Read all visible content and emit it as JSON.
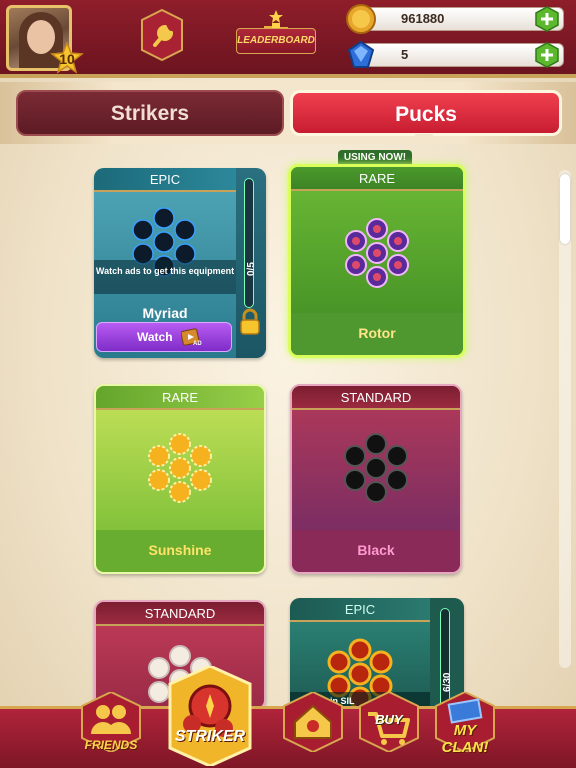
{
  "header": {
    "level": "10",
    "leaderboard_label": "LEADERBOARD",
    "coins": "961880",
    "gems": "5"
  },
  "tabs": [
    {
      "label": "Strikers",
      "active": false
    },
    {
      "label": "Pucks",
      "active": true
    }
  ],
  "cards": [
    {
      "rarity": "EPIC",
      "name": "Myriad",
      "overlay_text": "Watch ads to get this equipment",
      "progress": "0/5",
      "button_label": "Watch",
      "ad_icon_label": "AD",
      "locked": true
    },
    {
      "rarity": "RARE",
      "name": "Rotor",
      "badge": "USING NOW!"
    },
    {
      "rarity": "RARE",
      "name": "Sunshine"
    },
    {
      "rarity": "STANDARD",
      "name": "Black"
    },
    {
      "rarity": "STANDARD",
      "name": ""
    },
    {
      "rarity": "EPIC",
      "name": "",
      "progress": "6/30",
      "overlay_text": "in SIL"
    }
  ],
  "bottom_nav": [
    {
      "label": "FRIENDS"
    },
    {
      "label": "STRIKER"
    },
    {
      "label": ""
    },
    {
      "label": "BUY"
    },
    {
      "label": "MY CLAN!"
    }
  ],
  "colors": {
    "header": "#8e1e2a",
    "active_tab": "#e42b3f",
    "gold": "#ffd24a"
  }
}
